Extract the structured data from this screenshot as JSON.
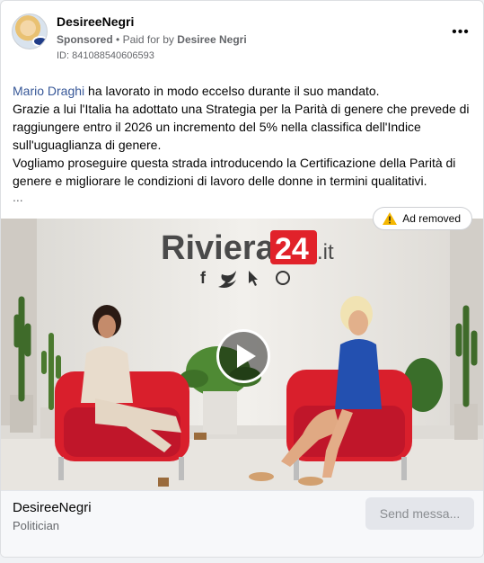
{
  "post": {
    "author": "DesireeNegri",
    "sponsored": "Sponsored",
    "paid_for_prefix": "Paid for by",
    "paid_for_name": "Desiree Negri",
    "dot": "•",
    "ad_id": "ID: 841088540606593",
    "more_glyph": "•••",
    "text_link": "Mario Draghi",
    "text_line1_rest": " ha lavorato in modo eccelso durante il suo mandato.",
    "text_para2": "Grazie a lui l'Italia ha adottato una Strategia per la Parità di genere che prevede di raggiungere entro il 2026 un incremento del 5% nella classifica dell'Indice sull'uguaglianza di genere.",
    "text_para3": "Vogliamo proseguire questa strada introducendo la Certificazione della Parità di genere e migliorare le condizioni di lavoro delle donne in termini qualitativi.",
    "ellipsis": "..."
  },
  "media": {
    "removed_label": "Ad removed",
    "brand_text": "Riviera",
    "brand_num": "24",
    "brand_suffix": ".it",
    "social_f": "f"
  },
  "footer": {
    "page_name": "DesireeNegri",
    "category": "Politician",
    "send_label": "Send messa..."
  },
  "colors": {
    "link": "#385898",
    "brand_red": "#e1222a",
    "chair_red": "#d91f2c",
    "dress_blue": "#2350b0"
  }
}
